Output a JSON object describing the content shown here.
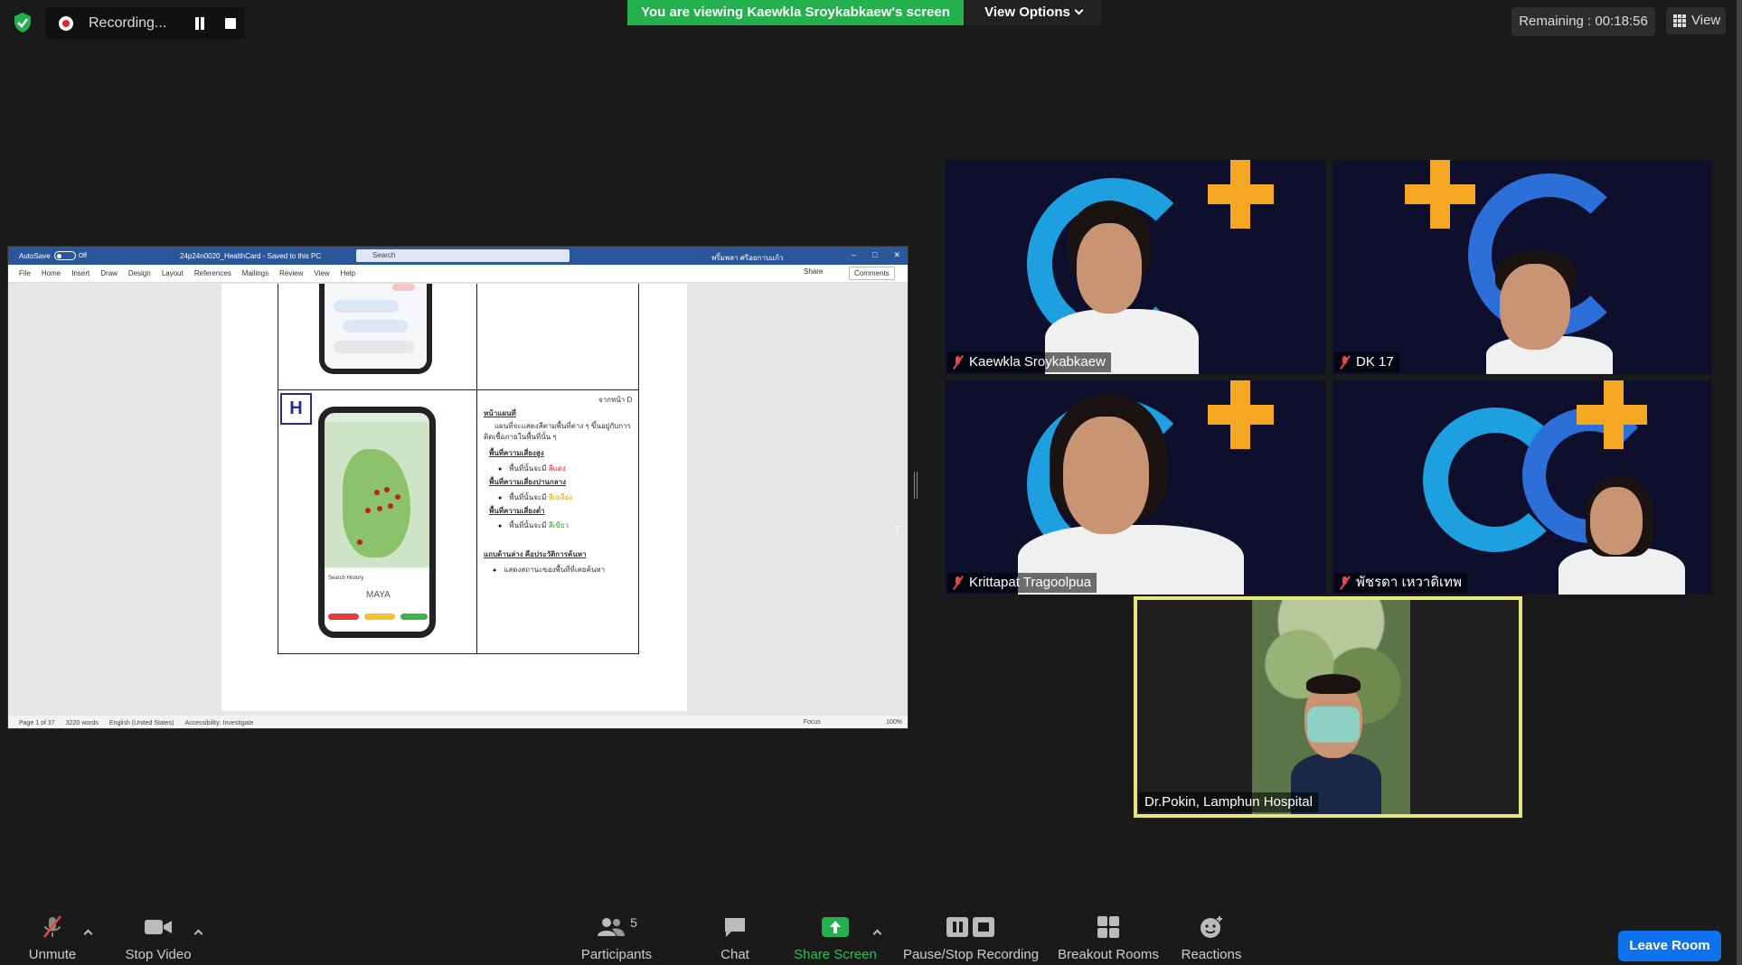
{
  "recording": {
    "label": "Recording..."
  },
  "banner": {
    "viewing_text": "You are viewing Kaewkla Sroykabkaew's screen",
    "view_options": "View Options"
  },
  "timer": {
    "remaining": "Remaining : 00:18:56"
  },
  "view_button": {
    "label": "View"
  },
  "shared_doc": {
    "autosave": "AutoSave",
    "autosave_state": "Off",
    "filename": "24p24n0020_HealthCard - Saved to this PC",
    "search_placeholder": "Search",
    "user": "พริ้มพลา ศรีอยกาบแก้ว",
    "ribbon_tabs": [
      "File",
      "Home",
      "Insert",
      "Draw",
      "Design",
      "Layout",
      "References",
      "Mailings",
      "Review",
      "View",
      "Help"
    ],
    "share_label": "Share",
    "comments_label": "Comments",
    "section_letter": "H",
    "page_ref": "จากหน้า D",
    "heading_map": "หน้าแผนที่",
    "para_map": "แผนที่จะแสดงสีตามพื้นที่ต่าง ๆ ขึ้นอยู่กับการติดเชื้อภายในพื้นที่นั้น ๆ",
    "high_risk": "พื้นที่ความเสี่ยงสูง",
    "high_risk_item": "พื้นที่นั้นจะมี",
    "high_risk_color": "สีแดง",
    "mid_risk": "พื้นที่ความเสี่ยงปานกลาง",
    "mid_risk_item": "พื้นที่นั้นจะมี",
    "mid_risk_color": "สีเหลือง",
    "low_risk": "พื้นที่ความเสี่ยงต่ำ",
    "low_risk_item": "พื้นที่นั้นจะมี",
    "low_risk_color": "สีเขียว",
    "heading_history": "แถบด้านล่าง คือประวัติการค้นหา",
    "history_item": "แสดงสถานะของพื้นที่ที่เคยค้นหา",
    "phone_search_history": "Search History",
    "phone_maya": "MAYA",
    "status": {
      "page": "Page 1 of 37",
      "words": "3220 words",
      "language": "English (United States)",
      "accessibility": "Accessibility: Investigate",
      "focus": "Focus",
      "zoom": "100%"
    }
  },
  "participants_tiles": [
    {
      "name": "Kaewkla Sroykabkaew",
      "muted": true
    },
    {
      "name": "DK 17",
      "muted": true
    },
    {
      "name": "Krittapat Tragoolpua",
      "muted": true
    },
    {
      "name": "พัชรดา เหวาดิเทพ",
      "muted": true
    },
    {
      "name": "Dr.Pokin, Lamphun Hospital",
      "muted": false
    }
  ],
  "toolbar": {
    "unmute": "Unmute",
    "stop_video": "Stop Video",
    "participants": "Participants",
    "participants_count": "5",
    "chat": "Chat",
    "share_screen": "Share Screen",
    "pause_stop_recording": "Pause/Stop Recording",
    "breakout_rooms": "Breakout Rooms",
    "reactions": "Reactions",
    "leave_room": "Leave Room"
  },
  "colors": {
    "banner_green": "#22b14c",
    "leave_blue": "#0e72ed",
    "active_speaker": "#e4e77a",
    "muted_red": "#e34646"
  }
}
